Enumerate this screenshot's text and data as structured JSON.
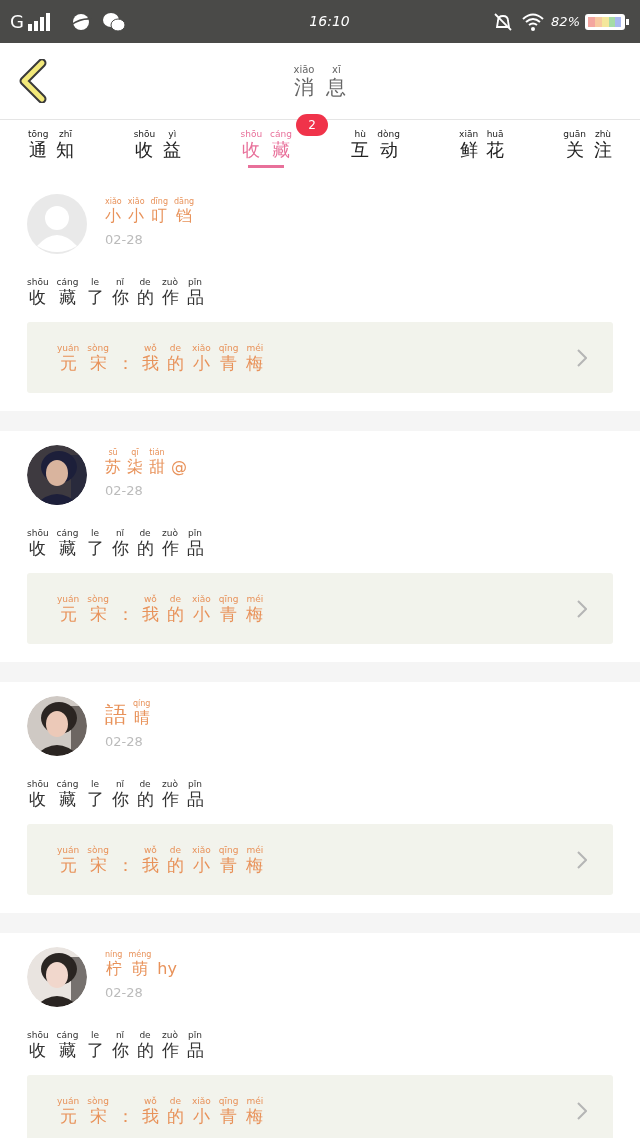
{
  "status_bar": {
    "network": "G",
    "time": "16:10",
    "battery": "82%"
  },
  "header": {
    "title": [
      {
        "c": "消",
        "py": "xiāo"
      },
      {
        "c": "息",
        "py": "xī"
      }
    ]
  },
  "tabs": [
    {
      "label": [
        {
          "c": "通",
          "py": "tōng"
        },
        {
          "c": "知",
          "py": "zhī"
        }
      ],
      "selected": false
    },
    {
      "label": [
        {
          "c": "收",
          "py": "shōu"
        },
        {
          "c": "益",
          "py": "yì"
        }
      ],
      "selected": false
    },
    {
      "label": [
        {
          "c": "收",
          "py": "shōu"
        },
        {
          "c": "藏",
          "py": "cáng"
        }
      ],
      "selected": true,
      "badge": "2"
    },
    {
      "label": [
        {
          "c": "互",
          "py": "hù"
        },
        {
          "c": "动",
          "py": "dòng"
        }
      ],
      "selected": false
    },
    {
      "label": [
        {
          "c": "鲜",
          "py": "xiān"
        },
        {
          "c": "花",
          "py": "huā"
        }
      ],
      "selected": false
    },
    {
      "label": [
        {
          "c": "关",
          "py": "guān"
        },
        {
          "c": "注",
          "py": "zhù"
        }
      ],
      "selected": false
    }
  ],
  "messages": [
    {
      "avatar": {
        "kind": "default"
      },
      "name": [
        {
          "c": "小",
          "py": "xiǎo"
        },
        {
          "c": "小",
          "py": "xiǎo"
        },
        {
          "c": "叮",
          "py": "dīng"
        },
        {
          "c": "铛",
          "py": "dāng"
        }
      ],
      "date": "02-28",
      "text": [
        {
          "c": "收",
          "py": "shōu"
        },
        {
          "c": "藏",
          "py": "cáng"
        },
        {
          "c": "了",
          "py": "le"
        },
        {
          "c": "你",
          "py": "nǐ"
        },
        {
          "c": "的",
          "py": "de"
        },
        {
          "c": "作",
          "py": "zuò"
        },
        {
          "c": "品",
          "py": "pǐn"
        }
      ],
      "work": [
        {
          "c": "元",
          "py": "yuán"
        },
        {
          "c": "宋",
          "py": "sòng"
        },
        {
          "c": "："
        },
        {
          "c": "我",
          "py": "wǒ"
        },
        {
          "c": "的",
          "py": "de"
        },
        {
          "c": "小",
          "py": "xiǎo"
        },
        {
          "c": "青",
          "py": "qīng"
        },
        {
          "c": "梅",
          "py": "méi"
        }
      ]
    },
    {
      "avatar": {
        "kind": "picture"
      },
      "name": [
        {
          "c": "苏",
          "py": "sū"
        },
        {
          "c": "柒",
          "py": "qī"
        },
        {
          "c": "甜",
          "py": "tián"
        },
        {
          "c": "@"
        }
      ],
      "date": "02-28",
      "text": [
        {
          "c": "收",
          "py": "shōu"
        },
        {
          "c": "藏",
          "py": "cáng"
        },
        {
          "c": "了",
          "py": "le"
        },
        {
          "c": "你",
          "py": "nǐ"
        },
        {
          "c": "的",
          "py": "de"
        },
        {
          "c": "作",
          "py": "zuò"
        },
        {
          "c": "品",
          "py": "pǐn"
        }
      ],
      "work": [
        {
          "c": "元",
          "py": "yuán"
        },
        {
          "c": "宋",
          "py": "sòng"
        },
        {
          "c": "："
        },
        {
          "c": "我",
          "py": "wǒ"
        },
        {
          "c": "的",
          "py": "de"
        },
        {
          "c": "小",
          "py": "xiǎo"
        },
        {
          "c": "青",
          "py": "qīng"
        },
        {
          "c": "梅",
          "py": "méi"
        }
      ]
    },
    {
      "avatar": {
        "kind": "picture"
      },
      "name": [
        {
          "c": "語",
          "big": true
        },
        {
          "c": "晴",
          "py": "qíng"
        }
      ],
      "date": "02-28",
      "text": [
        {
          "c": "收",
          "py": "shōu"
        },
        {
          "c": "藏",
          "py": "cáng"
        },
        {
          "c": "了",
          "py": "le"
        },
        {
          "c": "你",
          "py": "nǐ"
        },
        {
          "c": "的",
          "py": "de"
        },
        {
          "c": "作",
          "py": "zuò"
        },
        {
          "c": "品",
          "py": "pǐn"
        }
      ],
      "work": [
        {
          "c": "元",
          "py": "yuán"
        },
        {
          "c": "宋",
          "py": "sòng"
        },
        {
          "c": "："
        },
        {
          "c": "我",
          "py": "wǒ"
        },
        {
          "c": "的",
          "py": "de"
        },
        {
          "c": "小",
          "py": "xiǎo"
        },
        {
          "c": "青",
          "py": "qīng"
        },
        {
          "c": "梅",
          "py": "méi"
        }
      ]
    },
    {
      "avatar": {
        "kind": "picture"
      },
      "name": [
        {
          "c": "柠",
          "py": "níng"
        },
        {
          "c": "萌",
          "py": "méng"
        },
        {
          "c": "hy"
        }
      ],
      "date": "02-28",
      "text": [
        {
          "c": "收",
          "py": "shōu"
        },
        {
          "c": "藏",
          "py": "cáng"
        },
        {
          "c": "了",
          "py": "le"
        },
        {
          "c": "你",
          "py": "nǐ"
        },
        {
          "c": "的",
          "py": "de"
        },
        {
          "c": "作",
          "py": "zuò"
        },
        {
          "c": "品",
          "py": "pǐn"
        }
      ],
      "work": [
        {
          "c": "元",
          "py": "yuán"
        },
        {
          "c": "宋",
          "py": "sòng"
        },
        {
          "c": "："
        },
        {
          "c": "我",
          "py": "wǒ"
        },
        {
          "c": "的",
          "py": "de"
        },
        {
          "c": "小",
          "py": "xiǎo"
        },
        {
          "c": "青",
          "py": "qīng"
        },
        {
          "c": "梅",
          "py": "méi"
        }
      ]
    }
  ]
}
